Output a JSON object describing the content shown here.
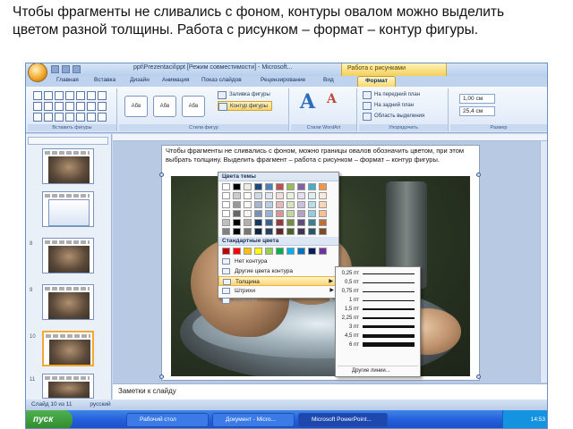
{
  "caption": "Чтобы фрагменты не сливались с фоном, контуры овалом можно выделить цветом разной толщины. Работа с рисунком – формат – контур фигуры.",
  "window": {
    "title": "ppt\\Prezentacii\\ppt [Режим совместимости] - Microsoft...",
    "contextual_tab": "Работа с рисунками"
  },
  "tabs": [
    "Главная",
    "Вставка",
    "Дизайн",
    "Анимация",
    "Показ слайдов",
    "Рецензирование",
    "Вид",
    "Формат"
  ],
  "ribbon": {
    "group_insert_shapes": "Вставить фигуры",
    "group_shape_styles": "Стили фигур",
    "group_wordart": "Стили WordArt",
    "group_arrange": "Упорядочить",
    "group_size": "Размер",
    "style_sample": "Абв",
    "shape_fill": "Заливка фигуры",
    "shape_outline": "Контур фигуры",
    "bring_front": "На передний план",
    "send_back": "На задний план",
    "selection_pane": "Область выделения",
    "height_value": "1,00 см",
    "width_value": "25,4 см"
  },
  "slide_text": "Чтобы фрагменты не сливались с фоном, можно границы овалов обозначить цветом, при этом выбрать толщину. Выделить фрагмент – работа с рисунком – формат – контур фигуры.",
  "outline_menu": {
    "theme_colors": "Цвета темы",
    "standard_colors": "Стандартные цвета",
    "no_outline": "Нет контура",
    "more_colors": "Другие цвета контура",
    "weight": "Толщина",
    "dashes": "Штрихи",
    "arrows": "Стрелки"
  },
  "weight_menu": {
    "items": [
      "0,25 пт",
      "0,5 пт",
      "0,75 пт",
      "1 пт",
      "1,5 пт",
      "2,25 пт",
      "3 пт",
      "4,5 пт",
      "6 пт"
    ],
    "more": "Другие линии..."
  },
  "notes_placeholder": "Заметки к слайду",
  "status": {
    "slide_info": "Слайд 10 из 11",
    "language": "русский"
  },
  "taskbar": {
    "start": "пуск",
    "items": [
      "Рабочий стол",
      "Документ - Micro...",
      "Microsoft PowerPoint..."
    ],
    "clock": "14:53"
  },
  "slide_numbers": [
    "8",
    "9",
    "10",
    "11"
  ],
  "colors": {
    "accent": "#f7d86a",
    "ribbon_blue": "#c9d9ee",
    "theme_palette": [
      "#ffffff",
      "#000000",
      "#eeece1",
      "#1f497d",
      "#4f81bd",
      "#c0504d",
      "#9bbb59",
      "#8064a2",
      "#4bacc6",
      "#f79646"
    ],
    "standard_palette": [
      "#c00000",
      "#ff0000",
      "#ffc000",
      "#ffff00",
      "#92d050",
      "#00b050",
      "#00b0f0",
      "#0070c0",
      "#002060",
      "#7030a0"
    ]
  }
}
